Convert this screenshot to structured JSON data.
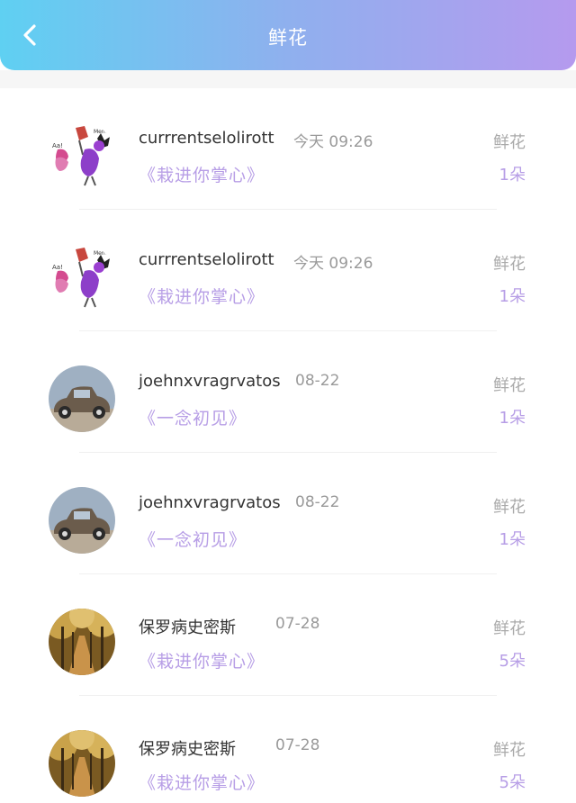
{
  "header": {
    "title": "鲜花",
    "back_icon": "chevron-left-icon"
  },
  "colors": {
    "gradient_start": "#5fd0f2",
    "gradient_end": "#b59aee",
    "accent": "#b79ee6"
  },
  "items": [
    {
      "name": "currrentselolirott",
      "date": "今天 09:26",
      "book": "《栽进你掌心》",
      "gift": "鲜花",
      "count": "1朵",
      "avatar": "cartoon-avatar"
    },
    {
      "name": "currrentselolirott",
      "date": "今天 09:26",
      "book": "《栽进你掌心》",
      "gift": "鲜花",
      "count": "1朵",
      "avatar": "cartoon-avatar"
    },
    {
      "name": "joehnxvragrvatos",
      "date": "08-22",
      "book": "《一念初见》",
      "gift": "鲜花",
      "count": "1朵",
      "avatar": "vintage-car-avatar"
    },
    {
      "name": "joehnxvragrvatos",
      "date": "08-22",
      "book": "《一念初见》",
      "gift": "鲜花",
      "count": "1朵",
      "avatar": "vintage-car-avatar"
    },
    {
      "name": "保罗病史密斯",
      "date": "07-28",
      "book": "《栽进你掌心》",
      "gift": "鲜花",
      "count": "5朵",
      "avatar": "autumn-trees-avatar"
    },
    {
      "name": "保罗病史密斯",
      "date": "07-28",
      "book": "《栽进你掌心》",
      "gift": "鲜花",
      "count": "5朵",
      "avatar": "autumn-trees-avatar"
    }
  ]
}
